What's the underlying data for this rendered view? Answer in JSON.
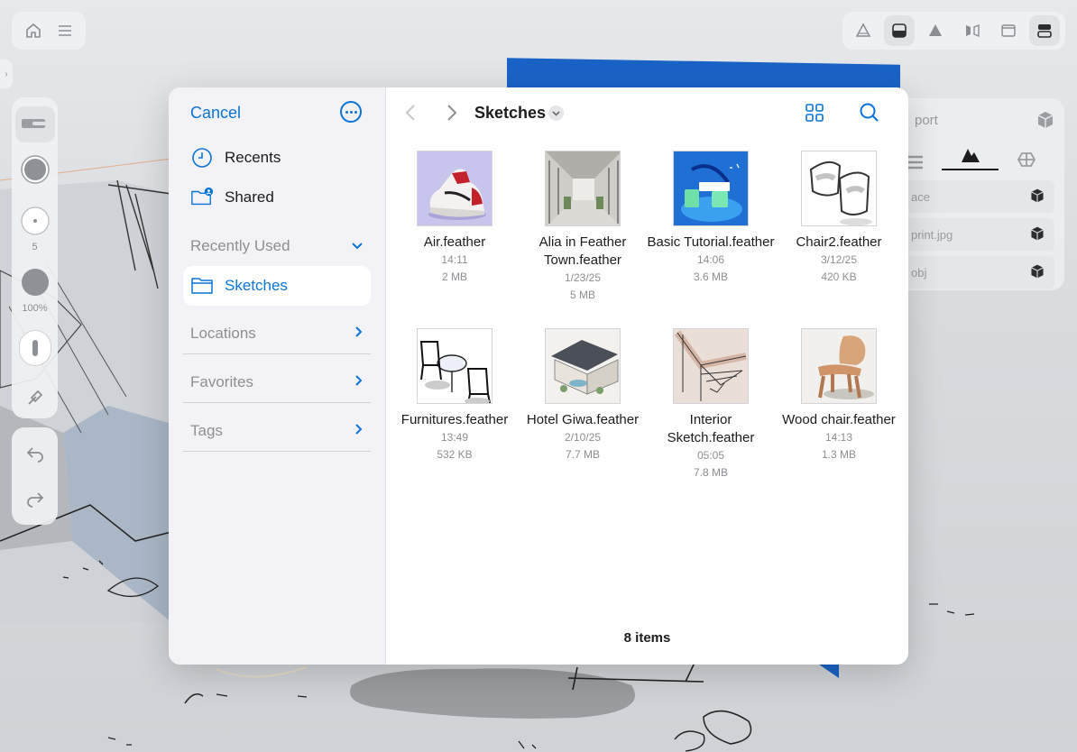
{
  "picker": {
    "cancel_label": "Cancel",
    "sidebar": {
      "recents_label": "Recents",
      "shared_label": "Shared",
      "recently_used_label": "Recently Used",
      "selected_folder_label": "Sketches",
      "locations_label": "Locations",
      "favorites_label": "Favorites",
      "tags_label": "Tags"
    },
    "folder_title": "Sketches",
    "files": [
      {
        "name": "Air.feather",
        "date": "14:11",
        "size": "2 MB"
      },
      {
        "name": "Alia in Feather Town.feather",
        "date": "1/23/25",
        "size": "5 MB"
      },
      {
        "name": "Basic Tutorial.feather",
        "date": "14:06",
        "size": "3.6 MB"
      },
      {
        "name": "Chair2.feather",
        "date": "3/12/25",
        "size": "420 KB"
      },
      {
        "name": "Furnitures.feather",
        "date": "13:49",
        "size": "532 KB"
      },
      {
        "name": "Hotel Giwa.feather",
        "date": "2/10/25",
        "size": "7.7 MB"
      },
      {
        "name": "Interior Sketch.feather",
        "date": "05:05",
        "size": "7.8 MB"
      },
      {
        "name": "Wood chair.feather",
        "date": "14:13",
        "size": "1.3 MB"
      }
    ],
    "item_count": "8 items"
  },
  "tools": {
    "brush_size": "5",
    "opacity": "100%"
  },
  "inspector": {
    "title_partial": "port",
    "rows": [
      "ace",
      "print.jpg",
      "obj"
    ]
  },
  "colors": {
    "accent": "#0a74d9",
    "brand_blue": "#1a63c6",
    "sidebar_bg": "#f2f2f7"
  }
}
